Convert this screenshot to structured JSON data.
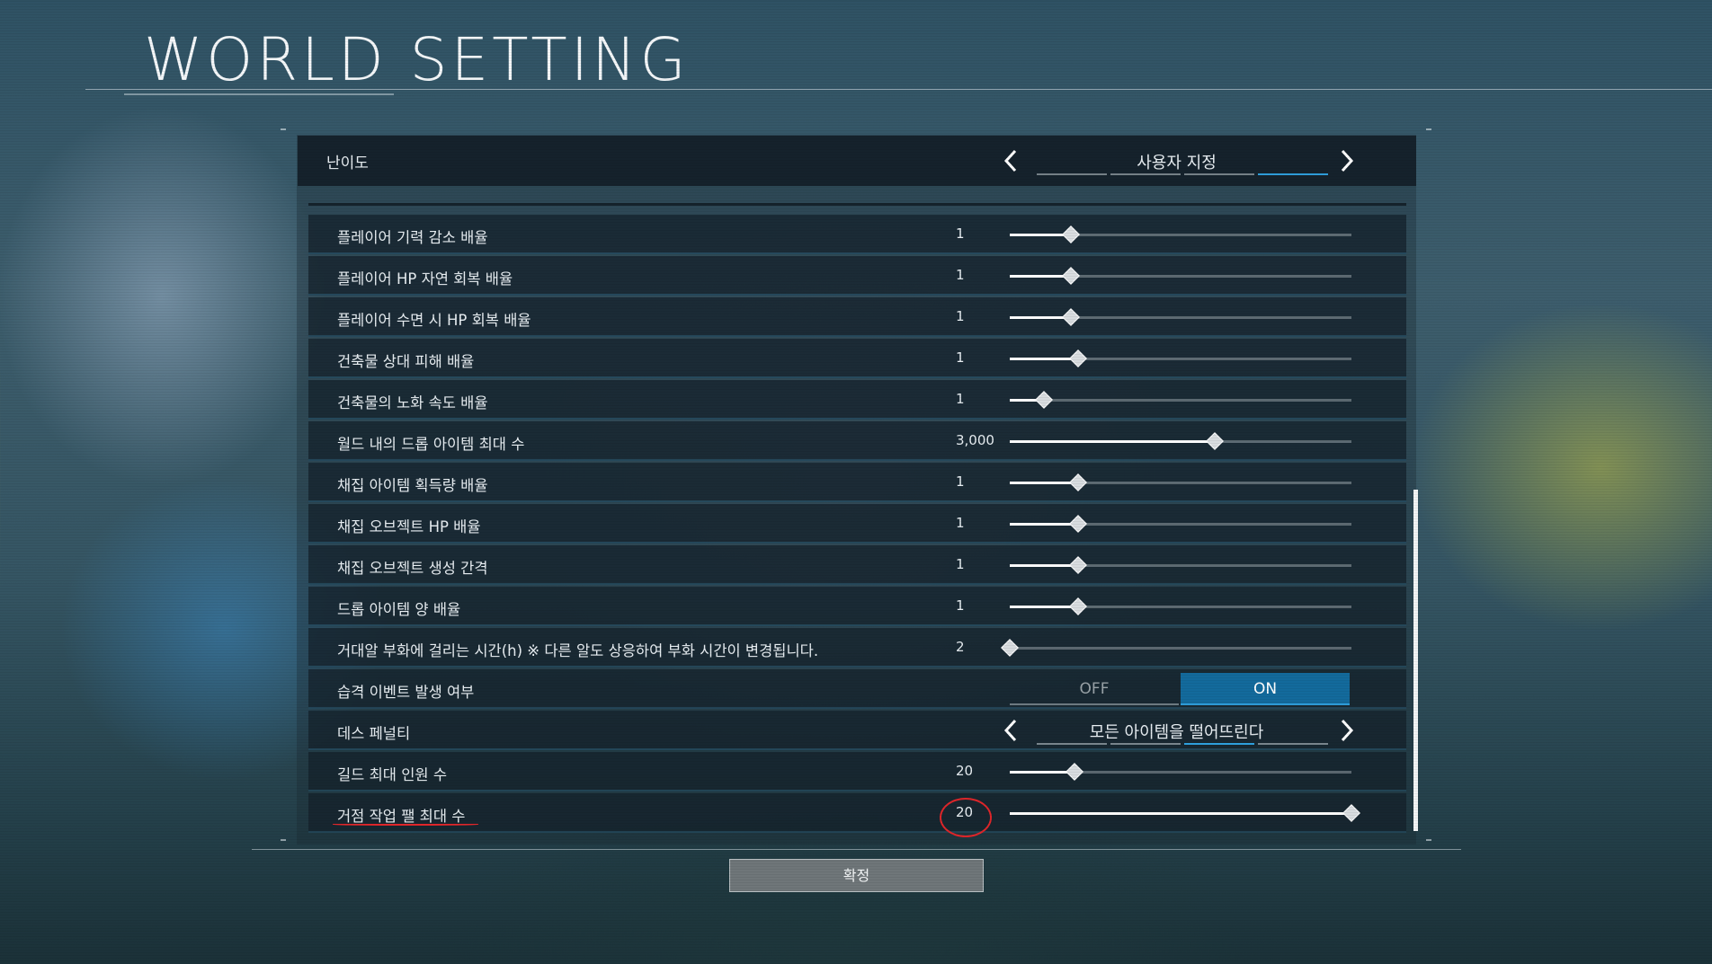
{
  "page": {
    "title": "WORLD SETTING"
  },
  "difficulty": {
    "label": "난이도",
    "value": "사용자 지정",
    "segments": 4,
    "active_segment": 4
  },
  "rows": [
    {
      "label": "플레이어 기력 감소 배율",
      "value": "1",
      "type": "slider",
      "level": 0.18
    },
    {
      "label": "플레이어 HP 자연 회복 배율",
      "value": "1",
      "type": "slider",
      "level": 0.18
    },
    {
      "label": "플레이어 수면 시 HP 회복 배율",
      "value": "1",
      "type": "slider",
      "level": 0.18
    },
    {
      "label": "건축물 상대 피해 배율",
      "value": "1",
      "type": "slider",
      "level": 0.2
    },
    {
      "label": "건축물의 노화 속도 배율",
      "value": "1",
      "type": "slider",
      "level": 0.1
    },
    {
      "label": "월드 내의 드롭 아이템 최대 수",
      "value": "3,000",
      "type": "slider",
      "level": 0.6
    },
    {
      "label": "채집 아이템 획득량 배율",
      "value": "1",
      "type": "slider",
      "level": 0.2
    },
    {
      "label": "채집 오브젝트 HP 배율",
      "value": "1",
      "type": "slider",
      "level": 0.2
    },
    {
      "label": "채집 오브젝트 생성 간격",
      "value": "1",
      "type": "slider",
      "level": 0.2
    },
    {
      "label": "드롭 아이템 양 배율",
      "value": "1",
      "type": "slider",
      "level": 0.2
    },
    {
      "label": "거대알 부화에 걸리는 시간(h) ※ 다른 알도 상응하여 부화 시간이 변경됩니다.",
      "value": "2",
      "type": "slider",
      "level": 0.0
    },
    {
      "label": "습격 이벤트 발생 여부",
      "type": "toggle",
      "off_label": "OFF",
      "on_label": "ON",
      "state": "ON"
    },
    {
      "label": "데스 페널티",
      "type": "selector",
      "value": "모든 아이템을 떨어뜨린다",
      "segments": 4,
      "active_segment": 3
    },
    {
      "label": "길드 최대 인원 수",
      "value": "20",
      "type": "slider",
      "level": 0.19
    },
    {
      "label": "거점 작업 팰 최대 수",
      "value": "20",
      "type": "slider",
      "level": 1.0
    }
  ],
  "confirm_label": "확정",
  "colors": {
    "accent": "#136a9c",
    "annotation": "#e0262a"
  }
}
